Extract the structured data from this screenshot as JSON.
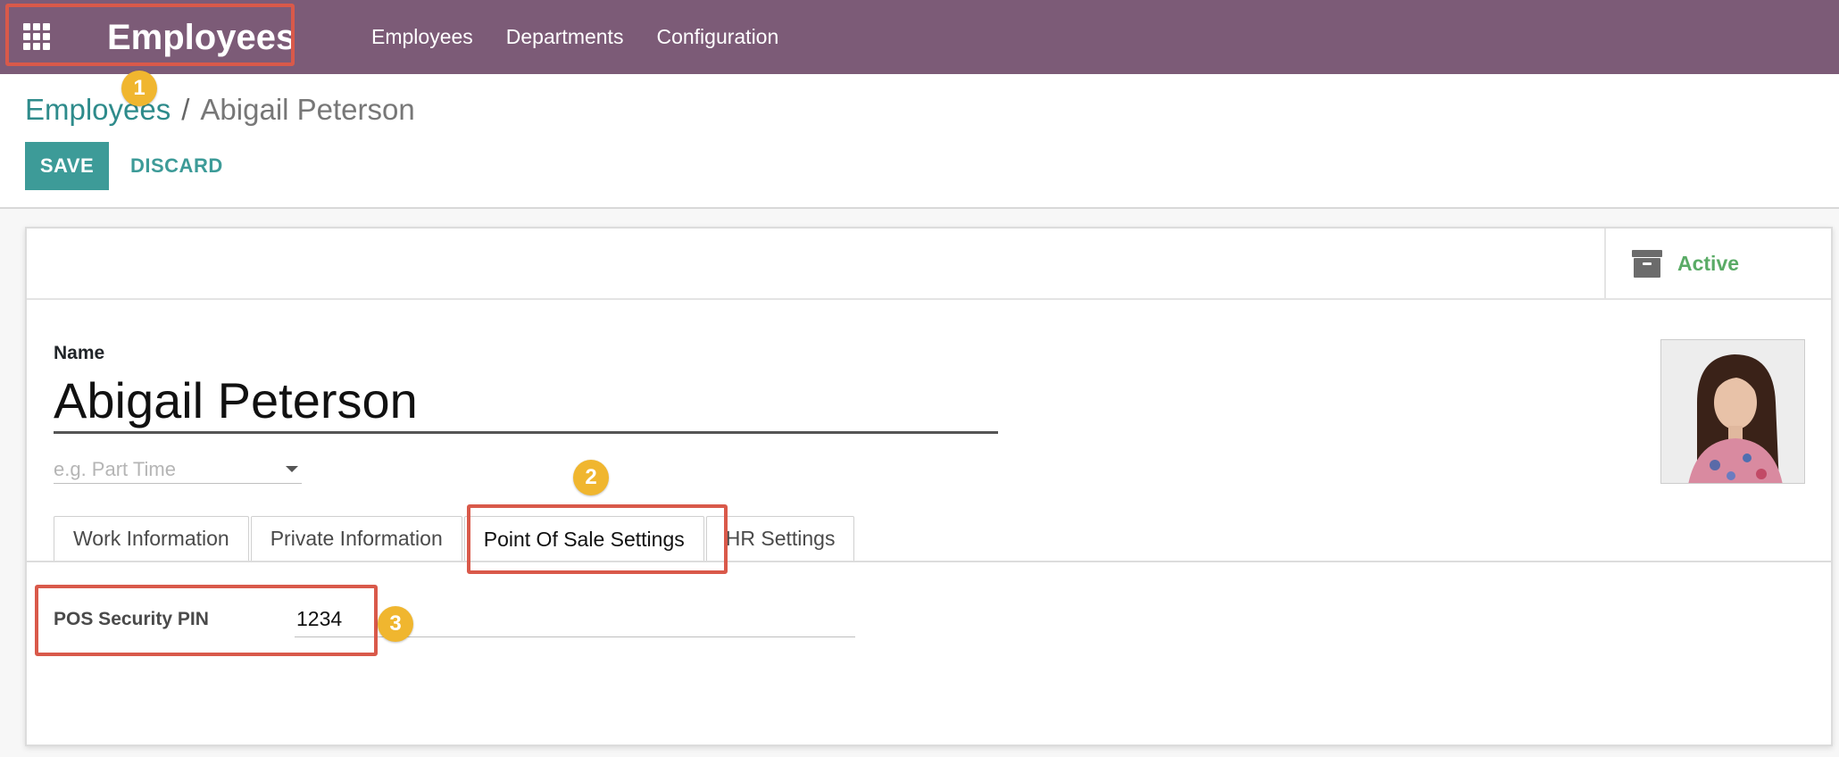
{
  "navbar": {
    "brand": "Employees",
    "menu": [
      "Employees",
      "Departments",
      "Configuration"
    ]
  },
  "breadcrumb": {
    "parent": "Employees",
    "separator": "/",
    "current": "Abigail Peterson"
  },
  "buttons": {
    "save": "SAVE",
    "discard": "DISCARD"
  },
  "status_button": {
    "label": "Active",
    "icon": "archive-icon"
  },
  "form": {
    "name_label": "Name",
    "name_value": "Abigail Peterson",
    "job_placeholder": "e.g. Part Time"
  },
  "tabs": [
    "Work Information",
    "Private Information",
    "Point Of Sale Settings",
    "HR Settings"
  ],
  "active_tab": "Point Of Sale Settings",
  "pos": {
    "pin_label": "POS Security PIN",
    "pin_value": "1234"
  },
  "markers": [
    "1",
    "2",
    "3"
  ],
  "colors": {
    "navbar": "#7c5b77",
    "primary": "#3d9b98",
    "highlight": "#d9594a",
    "marker": "#f0b62f",
    "active": "#5aab66"
  }
}
